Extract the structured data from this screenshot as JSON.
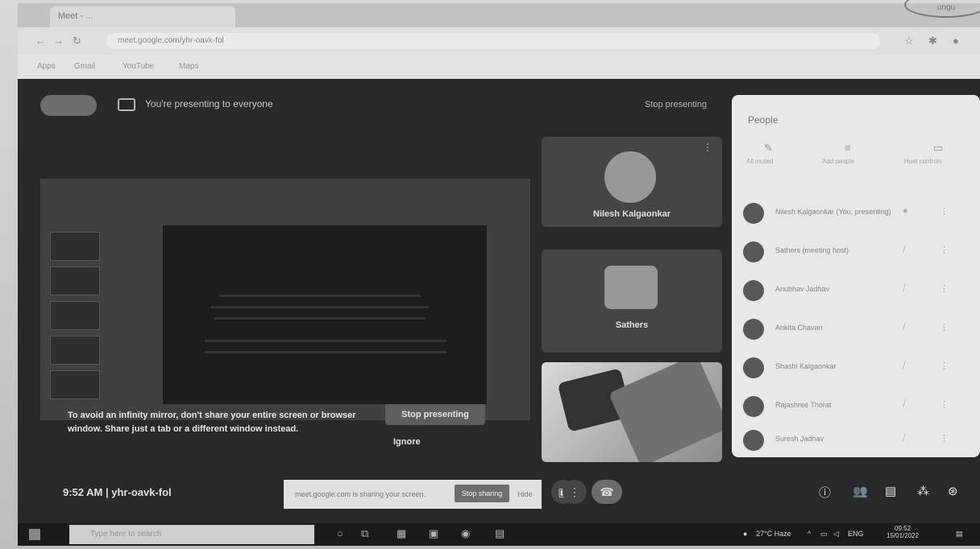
{
  "browser": {
    "tab_title": "Meet - ...",
    "url": "meet.google.com/yhr-oavk-fol",
    "bookmarks": [
      "Apps",
      "Gmail",
      "YouTube",
      "Maps"
    ]
  },
  "present_banner": {
    "text": "You're presenting to everyone",
    "stop_label": "Stop presenting"
  },
  "participants": [
    {
      "name": "Nilesh Kalgaonkar"
    },
    {
      "name": "Sathers"
    }
  ],
  "warning": {
    "text": "To avoid an infinity mirror, don't share your entire screen or browser window. Share just a tab or a different window instead.",
    "stop_button": "Stop presenting",
    "ignore_button": "Ignore"
  },
  "meeting": {
    "time": "9:52 AM",
    "separator": "|",
    "code": "yhr-oavk-fol"
  },
  "share_bar": {
    "text": "meet.google.com is sharing your screen.",
    "stop_label": "Stop sharing",
    "hide_label": "Hide"
  },
  "people": {
    "title": "People",
    "tabs": [
      "All muted",
      "Add people",
      "Host controls"
    ],
    "list": [
      {
        "name": "Nilesh Kalgaonkar (You, presenting)"
      },
      {
        "name": "Sathers (meeting host)"
      },
      {
        "name": "Anubhav Jadhav"
      },
      {
        "name": "Ankita Chavan"
      },
      {
        "name": "Shashi Kalgaonkar"
      },
      {
        "name": "Rajashree Thorat"
      },
      {
        "name": "Suresh Jadhav"
      }
    ]
  },
  "taskbar": {
    "search_placeholder": "Type here to search",
    "weather": "27°C Haze",
    "language": "ENG",
    "time": "09:52",
    "date": "15/01/2022"
  },
  "stamp": "ungu"
}
